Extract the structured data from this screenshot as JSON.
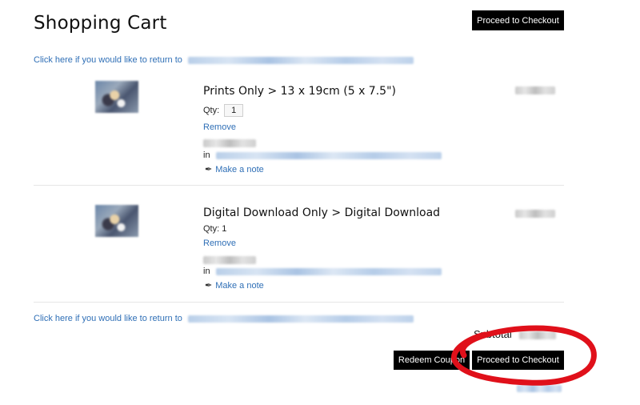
{
  "page": {
    "title": "Shopping Cart"
  },
  "checkout_top_label": "Proceed to Checkout",
  "return_link_text": "Click here if you would like to return to",
  "items": [
    {
      "title": "Prints Only > 13 x 19cm (5 x 7.5\")",
      "qty_label": "Qty:",
      "qty_value": "1",
      "remove_label": "Remove",
      "in_label": "in",
      "note_label": "Make a note"
    },
    {
      "title": "Digital Download Only > Digital Download",
      "qty_label": "Qty: 1",
      "remove_label": "Remove",
      "in_label": "in",
      "note_label": "Make a note"
    }
  ],
  "footer": {
    "subtotal_label": "Subtotal",
    "redeem_label": "Redeem Coupon",
    "checkout_label": "Proceed to Checkout"
  },
  "colors": {
    "link": "#2f6fb6",
    "button_bg": "#000000",
    "annotation": "#e0101a"
  },
  "icons": {
    "note": "pen-icon"
  }
}
